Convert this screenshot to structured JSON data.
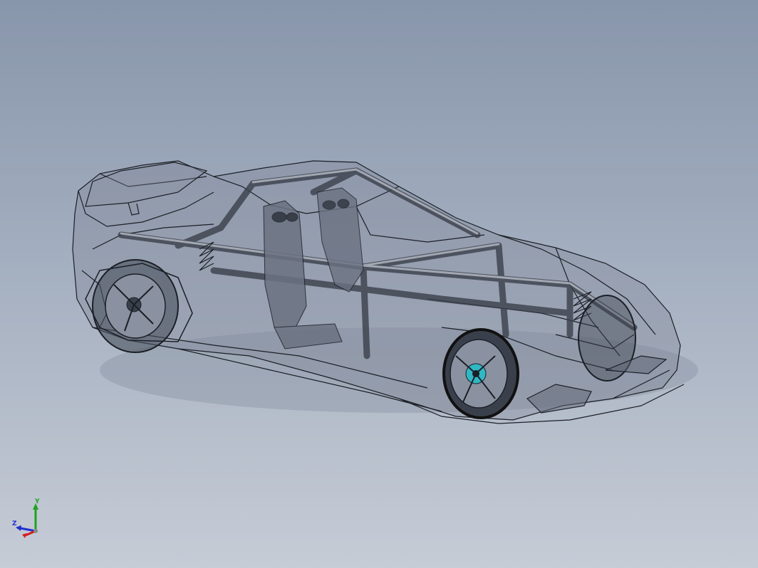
{
  "viewport": {
    "background_top": "#8896ab",
    "background_bottom": "#c6ccd6",
    "model_line_color": "#1b1f26",
    "model_fill_color": "#7d8595",
    "hub_accent_color": "#2fb8c4"
  },
  "triad": {
    "x_axis_color": "#d42020",
    "y_axis_color": "#1fa31f",
    "z_axis_color": "#2030d0",
    "y_label": "Y",
    "z_label": "Z"
  }
}
